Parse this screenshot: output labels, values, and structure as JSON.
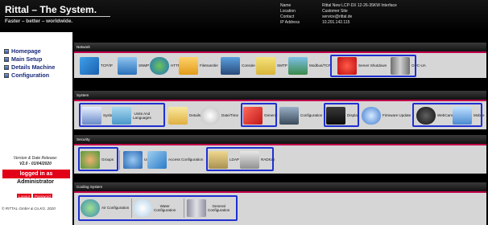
{
  "header": {
    "brand": "Rittal – The System.",
    "tagline": "Faster – better – worldwide.",
    "info": [
      {
        "key": "Name",
        "value": "Rittal New LCP-DX 12-26-35KW Interface"
      },
      {
        "key": "Location",
        "value": "Customer Site"
      },
      {
        "key": "Contact",
        "value": "service@rittal.de"
      },
      {
        "key": "IP Address",
        "value": "10.201.142.115"
      }
    ]
  },
  "sidebar": {
    "items": [
      {
        "label": "Homepage",
        "icon": "home-icon"
      },
      {
        "label": "Main Setup",
        "icon": "setup-icon"
      },
      {
        "label": "Details Machine",
        "icon": "details-icon"
      },
      {
        "label": "Configuration",
        "icon": "configuration-icon"
      }
    ],
    "version_label": "Version & Date Release:",
    "version_value": "V2.0 - 01/04/2020",
    "logged_in": "logged in as",
    "user": "Administrator",
    "logout": "Logout",
    "password": "Password",
    "copyright": "© RITTAL GmbH & Co.KG. 2020"
  },
  "sections": {
    "network": {
      "title": "Network",
      "items": [
        "TCP/IP",
        "SNMP",
        "HTTP",
        "Filetransfer",
        "Console",
        "SMTP",
        "Modbus/TCP",
        "Server Shutdown",
        "OPC-UA"
      ]
    },
    "system": {
      "title": "System",
      "items": [
        "Syslog",
        "Units And",
        "Languages",
        "Details",
        "Date/Time",
        "General",
        "Configuration",
        "Display",
        "Firmware Update",
        "WebCam",
        "Mobile"
      ]
    },
    "security": {
      "title": "Security",
      "items": [
        "Groups",
        "Users",
        "Access Configuration",
        "LDAP",
        "RADIUS"
      ]
    },
    "cooling": {
      "title": "Cooling System",
      "items": [
        "Air Configuration",
        "Water",
        "Configuration",
        "General",
        "Configuration"
      ]
    }
  },
  "colors": {
    "accent": "#e20019",
    "highlight": "#1f2fd0",
    "section_line": "#c0004a"
  }
}
